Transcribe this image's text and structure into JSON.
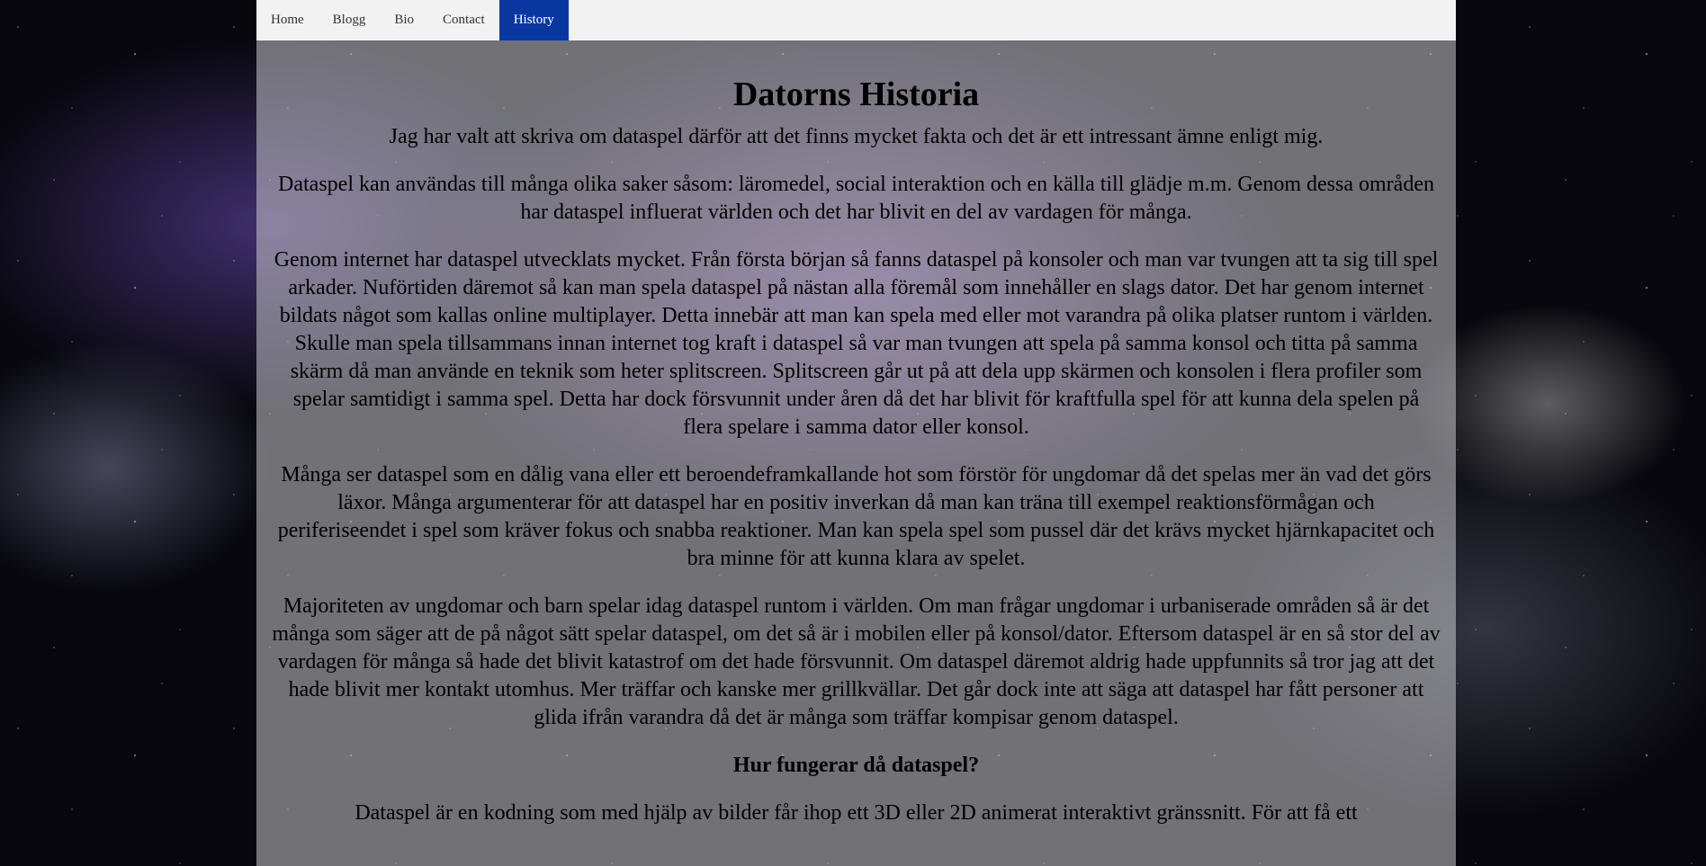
{
  "nav": {
    "items": [
      {
        "label": "Home"
      },
      {
        "label": "Blogg"
      },
      {
        "label": "Bio"
      },
      {
        "label": "Contact"
      },
      {
        "label": "History"
      }
    ],
    "active": "History"
  },
  "main": {
    "title": "Datorns Historia",
    "paragraphs": [
      "Jag har valt att skriva om dataspel därför att det finns mycket fakta och det är ett intressant ämne enligt mig.",
      "Dataspel kan användas till många olika saker såsom: läromedel, social interaktion och en källa till glädje m.m. Genom dessa områden har dataspel influerat världen och det har blivit en del av vardagen för många.",
      "Genom internet har dataspel utvecklats mycket. Från första början så fanns dataspel på konsoler och man var tvungen att ta sig till spel arkader. Nuförtiden däremot så kan man spela dataspel på nästan alla föremål som innehåller en slags dator. Det har genom internet bildats något som kallas online multiplayer. Detta innebär att man kan spela med eller mot varandra på olika platser runtom i världen. Skulle man spela tillsammans innan internet tog kraft i dataspel så var man tvungen att spela på samma konsol och titta på samma skärm då man använde en teknik som heter splitscreen. Splitscreen går ut på att dela upp skärmen och konsolen i flera profiler som spelar samtidigt i samma spel. Detta har dock försvunnit under åren då det har blivit för kraftfulla spel för att kunna dela spelen på flera spelare i samma dator eller konsol.",
      "Många ser dataspel som en dålig vana eller ett beroendeframkallande hot som förstör för ungdomar då det spelas mer än vad det görs läxor. Många argumenterar för att dataspel har en positiv inverkan då man kan träna till exempel reaktionsförmågan och periferiseendet i spel som kräver fokus och snabba reaktioner. Man kan spela spel som pussel där det krävs mycket hjärnkapacitet och bra minne för att kunna klara av spelet.",
      "Majoriteten av ungdomar och barn spelar idag dataspel runtom i världen. Om man frågar ungdomar i urbaniserade områden så är det många som säger att de på något sätt spelar dataspel, om det så är i mobilen eller på konsol/dator. Eftersom dataspel är en så stor del av vardagen för många så hade det blivit katastrof om det hade försvunnit. Om dataspel däremot aldrig hade uppfunnits så tror jag att det hade blivit mer kontakt utomhus. Mer träffar och kanske mer grillkvällar. Det går dock inte att säga att dataspel har fått personer att glida ifrån varandra då det är många som träffar kompisar genom dataspel."
    ],
    "subheading": "Hur fungerar då dataspel?",
    "last_paragraph": "Dataspel är en kodning som med hjälp av bilder får ihop ett 3D eller 2D animerat interaktivt gränssnitt. För att få ett"
  },
  "colors": {
    "nav_active_bg": "#0937a0",
    "nav_bg": "#f2f2f2"
  }
}
